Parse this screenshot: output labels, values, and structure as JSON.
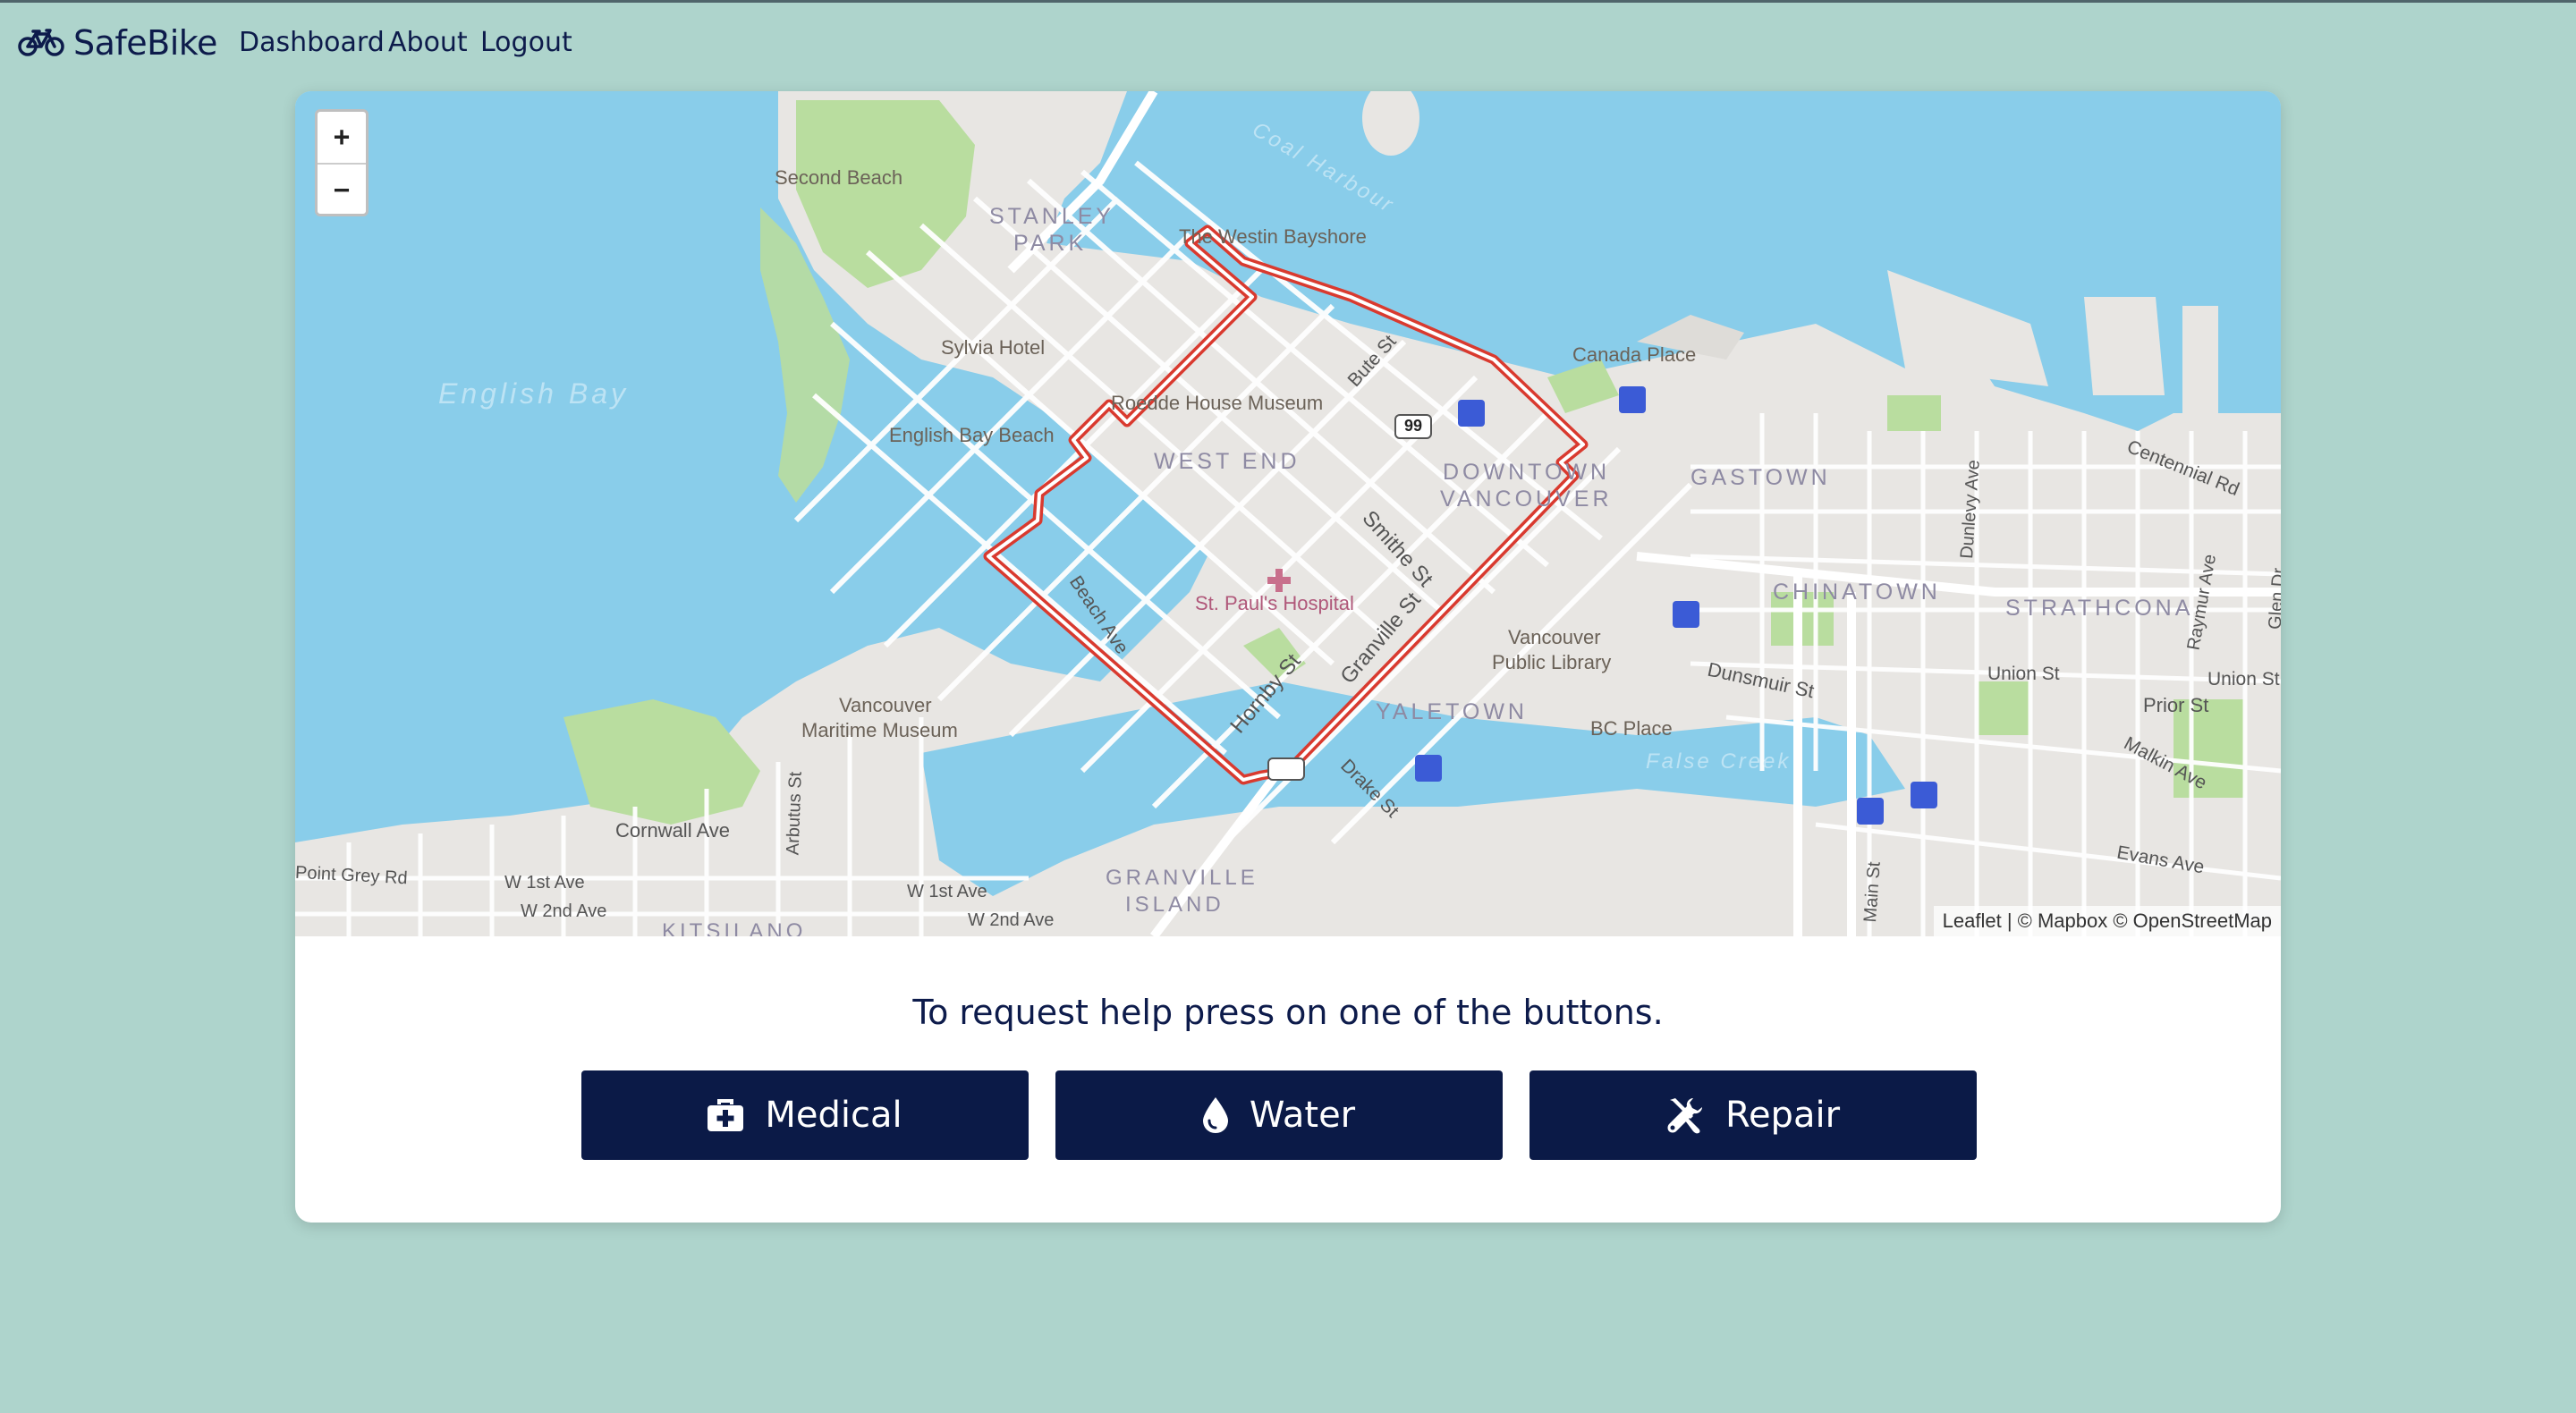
{
  "nav": {
    "brand": "SafeBike",
    "links": [
      "Dashboard",
      "About",
      "Logout"
    ]
  },
  "map": {
    "zoom_in": "+",
    "zoom_out": "−",
    "attribution": {
      "leaflet": "Leaflet",
      "rest": " | © Mapbox © OpenStreetMap"
    },
    "route_color": "#d93a2f",
    "labels": [
      {
        "text": "Second Beach",
        "cls": "poi"
      },
      {
        "text": "STANLEY",
        "cls": "district"
      },
      {
        "text": "PARK",
        "cls": "district"
      },
      {
        "text": "The Westin Bayshore",
        "cls": "poi"
      },
      {
        "text": "Sylvia Hotel",
        "cls": "poi"
      },
      {
        "text": "English Bay",
        "cls": "water"
      },
      {
        "text": "Roedde House Museum",
        "cls": "poi"
      },
      {
        "text": "English Bay Beach",
        "cls": "poi"
      },
      {
        "text": "WEST END",
        "cls": "district"
      },
      {
        "text": "Canada Place",
        "cls": "poi"
      },
      {
        "text": "DOWNTOWN",
        "cls": "district"
      },
      {
        "text": "VANCOUVER",
        "cls": "district"
      },
      {
        "text": "GASTOWN",
        "cls": "district"
      },
      {
        "text": "CHINATOWN",
        "cls": "district"
      },
      {
        "text": "STRATHCONA",
        "cls": "district"
      },
      {
        "text": "St. Paul's Hospital",
        "cls": "hospital"
      },
      {
        "text": "Vancouver",
        "cls": "poi"
      },
      {
        "text": "Public Library",
        "cls": "poi"
      },
      {
        "text": "Vancouver",
        "cls": "poi"
      },
      {
        "text": "Maritime Museum",
        "cls": "poi"
      },
      {
        "text": "YALETOWN",
        "cls": "district"
      },
      {
        "text": "BC Place",
        "cls": "poi"
      },
      {
        "text": "Dunsmuir St",
        "cls": "street"
      },
      {
        "text": "Union St",
        "cls": "street"
      },
      {
        "text": "Union St",
        "cls": "street"
      },
      {
        "text": "Prior St",
        "cls": "street"
      },
      {
        "text": "Malkin Ave",
        "cls": "street"
      },
      {
        "text": "Evans Ave",
        "cls": "street"
      },
      {
        "text": "Centennial Rd",
        "cls": "street"
      },
      {
        "text": "Dunlevy Ave",
        "cls": "street"
      },
      {
        "text": "Raymur Ave",
        "cls": "street"
      },
      {
        "text": "Glen Dr",
        "cls": "street"
      },
      {
        "text": "Bute St",
        "cls": "street"
      },
      {
        "text": "Smithe St",
        "cls": "street"
      },
      {
        "text": "Granville St",
        "cls": "street"
      },
      {
        "text": "Hornby St",
        "cls": "street"
      },
      {
        "text": "Beach Ave",
        "cls": "street"
      },
      {
        "text": "Drake St",
        "cls": "street"
      },
      {
        "text": "Arbutus St",
        "cls": "street"
      },
      {
        "text": "Main St",
        "cls": "street"
      },
      {
        "text": "Cornwall Ave",
        "cls": "street"
      },
      {
        "text": "Point Grey Rd",
        "cls": "street"
      },
      {
        "text": "W 1st Ave",
        "cls": "street"
      },
      {
        "text": "W 2nd Ave",
        "cls": "street"
      },
      {
        "text": "W 1st Ave",
        "cls": "street"
      },
      {
        "text": "W 2nd Ave",
        "cls": "street"
      },
      {
        "text": "GRANVILLE",
        "cls": "district"
      },
      {
        "text": "ISLAND",
        "cls": "district"
      },
      {
        "text": "KITSILANO",
        "cls": "district"
      },
      {
        "text": "False Creek",
        "cls": "water"
      },
      {
        "text": "Coal Harbour",
        "cls": "water"
      },
      {
        "text": "99",
        "cls": "shield"
      }
    ]
  },
  "help": {
    "text": "To request help press on one of the buttons."
  },
  "buttons": [
    {
      "label": "Medical",
      "icon": "medkit-icon"
    },
    {
      "label": "Water",
      "icon": "water-drop-icon"
    },
    {
      "label": "Repair",
      "icon": "tools-icon"
    }
  ],
  "colors": {
    "page_bg": "#aed4cc",
    "brand": "#0d1b4b",
    "button_bg": "#0b1a47",
    "water": "#89cdea",
    "land": "#e8e6e3",
    "park": "#b9dd9f",
    "route": "#d93a2f"
  }
}
